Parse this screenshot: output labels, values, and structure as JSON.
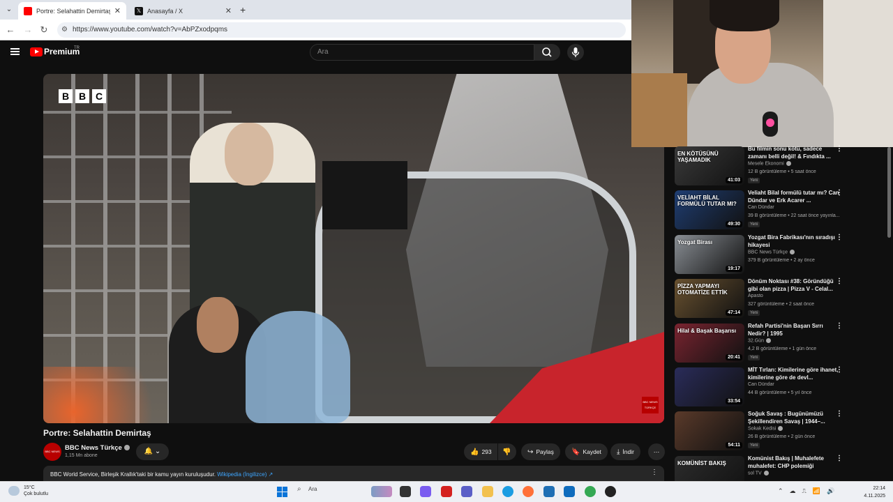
{
  "browser": {
    "tabs": [
      {
        "title": "Portre: Selahattin Demirtaş - Yo",
        "favicon_color": "#ff0000"
      },
      {
        "title": "Anasayfa / X",
        "favicon_color": "#111111"
      }
    ],
    "url": "https://www.youtube.com/watch?v=AbPZxodpqms"
  },
  "yt_header": {
    "brand": "Premium",
    "country": "TR",
    "search_placeholder": "Ara"
  },
  "video": {
    "bbc_letters": [
      "B",
      "B",
      "C"
    ],
    "watermark": "BBC NEWS TÜRKÇE",
    "title": "Portre: Selahattin Demirtaş"
  },
  "channel": {
    "avatar_text": "BBC NEWS",
    "name": "BBC News Türkçe",
    "subscribers": "1,15 Mn abone"
  },
  "actions": {
    "likes": "293",
    "share": "Paylaş",
    "save": "Kaydet",
    "download": "İndir"
  },
  "description": {
    "text": "BBC World Service, Birleşik Krallık'taki bir kamu yayın kuruluşudur.",
    "link": "Wikipedia (İngilizce) ↗"
  },
  "recommendations": [
    {
      "title": "Bu filmin sonu kötü, sadece zamanı belli değil! & Fındıkta ...",
      "channel": "Mesele Ekonomi",
      "verified": true,
      "meta": "12 B görüntüleme • 5 saat önce",
      "badge": "Yeni",
      "duration": "41:03",
      "thumb_text": "EN KÖTÜSÜNÜ YAŞAMADIK",
      "thumb_color": "#3a3a3a"
    },
    {
      "title": "Veliaht Bilal formülü tutar mı? Can Dündar ve Erk Acarer ...",
      "channel": "Can Dündar",
      "verified": false,
      "meta": "39 B görüntüleme • 22 saat önce yayınla...",
      "badge": "Yeni",
      "duration": "49:30",
      "thumb_text": "VELİAHT BİLAL FORMÜLÜ TUTAR MI?",
      "thumb_color": "#1f3e73"
    },
    {
      "title": "Yozgat Bira Fabrikası'nın sıradışı hikayesi",
      "channel": "BBC News Türkçe",
      "verified": true,
      "meta": "379 B görüntüleme • 2 ay önce",
      "badge": "",
      "duration": "19:17",
      "thumb_text": "Yozgat Birası",
      "thumb_color": "#8a8f95"
    },
    {
      "title": "Dönüm Noktası #38: Göründüğü gibi olan pizza | Pizza V - Celal...",
      "channel": "Apasto",
      "verified": false,
      "meta": "327 görüntüleme • 2 saat önce",
      "badge": "Yeni",
      "duration": "47:14",
      "thumb_text": "PİZZA YAPMAYI OTOMATİZE ETTİK",
      "thumb_color": "#6a5230"
    },
    {
      "title": "Refah Partisi'nin Başarı Sırrı Nedir? | 1995",
      "channel": "32.Gün",
      "verified": true,
      "meta": "4,2 B görüntüleme • 1 gün önce",
      "badge": "Yeni",
      "duration": "20:41",
      "thumb_text": "Hilal & Başak Başarısı",
      "thumb_color": "#7a2430"
    },
    {
      "title": "MİT Tırları: Kimilerine göre ihanet, kimilerine göre de devl...",
      "channel": "Can Dündar",
      "verified": false,
      "meta": "44 B görüntüleme • 5 yıl önce",
      "badge": "",
      "duration": "33:54",
      "thumb_text": "",
      "thumb_color": "#2a2c5a"
    },
    {
      "title": "Soğuk Savaş : Bugünümüzü Şekillendiren Savaş | 1944–...",
      "channel": "Sokak Kedisi",
      "verified": true,
      "meta": "26 B görüntüleme • 2 gün önce",
      "badge": "Yeni",
      "duration": "54:11",
      "thumb_text": "",
      "thumb_color": "#5a3a2a"
    },
    {
      "title": "Komünist Bakış | Muhalefete muhalefet: CHP polemiği",
      "channel": "sol TV",
      "verified": true,
      "meta": "",
      "badge": "",
      "duration": "",
      "thumb_text": "KOMÜNİST BAKIŞ",
      "thumb_color": "#2c2c2c"
    }
  ],
  "taskbar": {
    "temperature": "15°C",
    "weather": "Çok bulutlu",
    "search": "Ara",
    "time": "22:14",
    "date": "4.11.2025",
    "apps": [
      {
        "name": "task-view",
        "color": "#333333"
      },
      {
        "name": "copilot",
        "color": "#7a5cf0"
      },
      {
        "name": "acrobat",
        "color": "#d4211f"
      },
      {
        "name": "teams",
        "color": "#5b5fc7"
      },
      {
        "name": "explorer",
        "color": "#f2c14e"
      },
      {
        "name": "edge",
        "color": "#1b9de2"
      },
      {
        "name": "firefox",
        "color": "#ff7139"
      },
      {
        "name": "vscode",
        "color": "#1f6fb4"
      },
      {
        "name": "outlook",
        "color": "#0f6cbd"
      },
      {
        "name": "chrome",
        "color": "#34a853"
      },
      {
        "name": "obs",
        "color": "#222222"
      }
    ]
  }
}
